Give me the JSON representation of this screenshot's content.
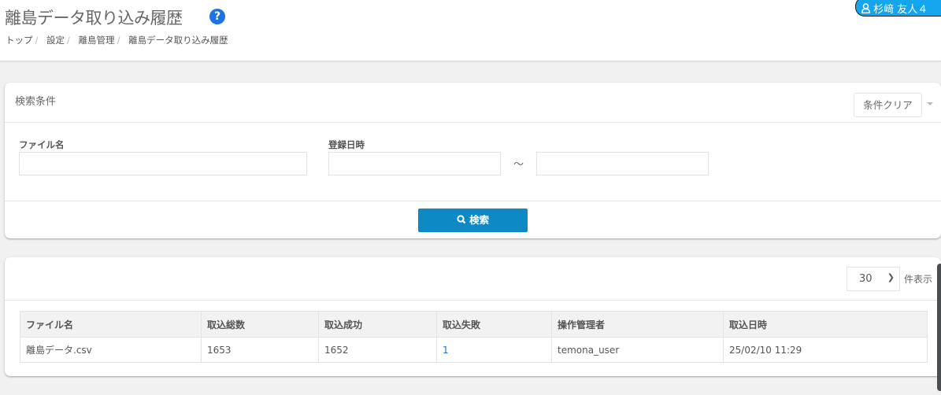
{
  "header": {
    "title": "離島データ取り込み履歴",
    "help_icon": "?",
    "breadcrumb": [
      "トップ",
      "設定",
      "離島管理",
      "離島データ取り込み履歴"
    ],
    "breadcrumb_sep": "/",
    "user": "杉﨑 友人４"
  },
  "search_panel": {
    "title": "検索条件",
    "clear_label": "条件クリア",
    "file_name_label": "ファイル名",
    "file_name_value": "",
    "date_label": "登録日時",
    "date_from": "",
    "date_to": "",
    "tilde": "～",
    "search_label": "検索"
  },
  "results": {
    "per_page": "30",
    "per_page_label": "件表示",
    "columns": [
      "ファイル名",
      "取込総数",
      "取込成功",
      "取込失敗",
      "操作管理者",
      "取込日時"
    ],
    "rows": [
      [
        "離島データ.csv",
        "1653",
        "1652",
        "1",
        "temona_user",
        "25/02/10 11:29"
      ]
    ]
  }
}
